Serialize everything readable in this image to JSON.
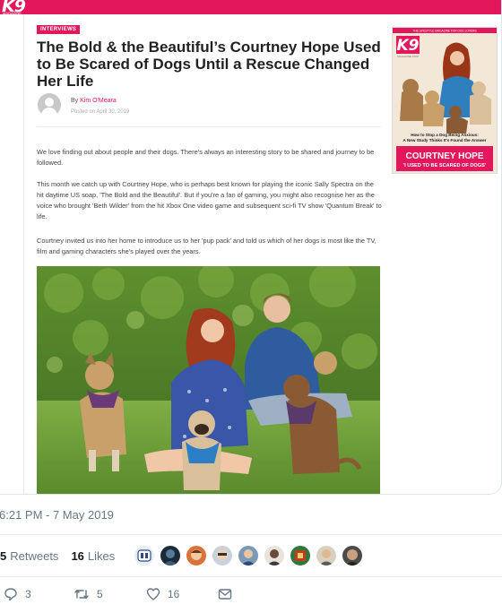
{
  "site": {
    "logo": "K9",
    "logo_sub": "MAGAZINE"
  },
  "article": {
    "category": "INTERVIEWS",
    "headline": "The Bold & the Beautiful’s Courtney Hope Used to Be Scared of Dogs Until a Rescue Changed Her Life",
    "byline_prefix": "By",
    "author": "Kim O'Meara",
    "posted": "Posted on April 30, 2019",
    "paragraphs": [
      "We love finding out about people and their dogs. There's always an interesting story to be shared and journey to be followed.",
      "This month we catch up with Courtney Hope, who is perhaps best known for playing the iconic Sally Spectra on the hit daytime US soap, 'The Bold and the Beautiful'. But if you're a fan of gaming, you might also recognise her as the voice who brought 'Beth Wilder' from the hit Xbox One video game and subsequent sci-fi TV show 'Quantum Break' to life.",
      "Courtney invited us into her home to introduce us to her 'pup pack' and told us which of her dogs is most like the TV, film and gaming characters she's played over the years."
    ]
  },
  "magazine": {
    "tagline": "THE LIFESTYLE MAGAZINE FOR DOG LOVERS",
    "logo": "K9",
    "logo_sub": "MAGAZINE.COM",
    "story_line1": "How to Stop a Dog Being Anxious:",
    "story_line2": "A New Study Thinks It's Found the Answer",
    "cover_name": "COURTNEY HOPE",
    "cover_quote": "'I USED TO BE SCARED OF DOGS'"
  },
  "tweet": {
    "timestamp": "6:21 PM - 7 May 2019",
    "retweets_count": "5",
    "retweets_label": "Retweets",
    "likes_count": "16",
    "likes_label": "Likes",
    "actions": {
      "reply_count": "3",
      "retweet_count": "5",
      "like_count": "16"
    }
  },
  "colors": {
    "brand": "#e3175c",
    "meta": "#657786"
  }
}
